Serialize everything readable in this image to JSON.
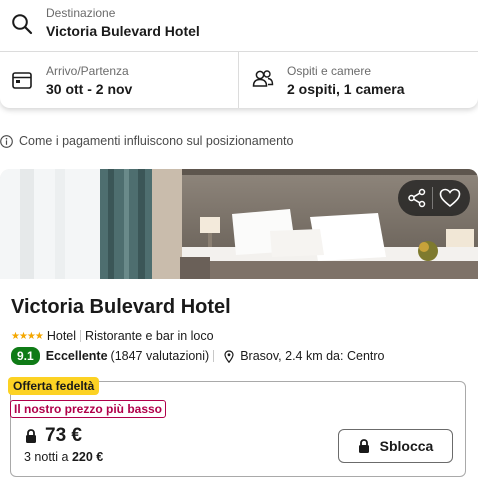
{
  "search": {
    "destination_label": "Destinazione",
    "destination_value": "Victoria Bulevard Hotel",
    "dates_label": "Arrivo/Partenza",
    "dates_value": "30 ott - 2 nov",
    "guests_label": "Ospiti e camere",
    "guests_value": "2 ospiti, 1 camera"
  },
  "info": {
    "text": "Come i pagamenti influiscono sul posizionamento"
  },
  "hotel": {
    "name": "Victoria Bulevard Hotel",
    "stars": 4,
    "type": "Hotel",
    "amenity": "Ristorante e bar in loco",
    "score": "9.1",
    "rating_word": "Eccellente",
    "reviews": "(1847 valutazioni)",
    "location": "Brasov, 2.4 km da: Centro"
  },
  "offer": {
    "loyalty_badge": "Offerta fedeltà",
    "best_price_badge": "Il nostro prezzo più basso",
    "price": "73 €",
    "nights_text": "3 notti a",
    "total": "220 €",
    "unlock_label": "Sblocca"
  },
  "icons": {
    "destination": "search-icon",
    "dates": "calendar-icon",
    "guests": "people-icon",
    "info": "info-icon",
    "share": "share-icon",
    "favorite": "heart-icon",
    "location": "location-pin-icon",
    "lock": "lock-icon"
  },
  "colors": {
    "score_bg": "#0f7b16",
    "loyalty_bg": "#fcd223",
    "best_price": "#b0004a",
    "stars": "#f4a700"
  }
}
